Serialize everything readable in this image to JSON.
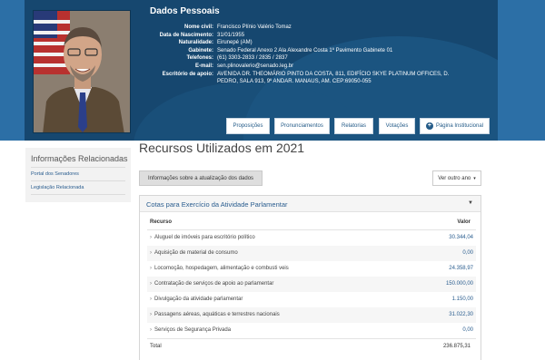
{
  "header": {
    "title": "Dados Pessoais",
    "fields": [
      {
        "label": "Nome civil:",
        "value": "Francisco Plínio Valério Tomaz"
      },
      {
        "label": "Data de Nascimento:",
        "value": "31/01/1955"
      },
      {
        "label": "Naturalidade:",
        "value": "Eirunepé (AM)"
      },
      {
        "label": "Gabinete:",
        "value": "Senado Federal Anexo 2 Ala Alexandre Costa 1º Pavimento Gabinete 01"
      },
      {
        "label": "Telefones:",
        "value": "(61) 3303-2833 / 2835 / 2837"
      },
      {
        "label": "E-mail:",
        "value": "sen.plinovalerio@senado.leg.br"
      },
      {
        "label": "Escritório de apoio:",
        "value": "AVENIDA DR. THEOMÁRIO PINTO DA COSTA, 811, EDIFÍCIO SKYE PLATINUM OFFICES, D.",
        "value2": "PEDRO, SALA 913, 9º ANDAR. MANAUS, AM. CEP:69050-055"
      }
    ],
    "buttons": {
      "proposicoes": "Proposições",
      "pronunciamentos": "Pronunciamentos",
      "relatorias": "Relatorias",
      "votacoes": "Votações",
      "pagina": "Página Institucional"
    }
  },
  "sidebar": {
    "title": "Informações Relacionadas",
    "links": [
      "Portal dos Senadores",
      "Legislação Relacionada"
    ]
  },
  "main": {
    "title": "Recursos Utilizados em 2021",
    "info_button": "Informações sobre a atualização dos dados",
    "year_button": "Ver outro ano",
    "panel": {
      "title": "Cotas para Exercício da Atividade Parlamentar",
      "col_recurso": "Recurso",
      "col_valor": "Valor",
      "rows": [
        {
          "label": "Aluguel de imóveis para escritório político",
          "value": "30.344,04"
        },
        {
          "label": "Aquisição de material de consumo",
          "value": "0,00"
        },
        {
          "label": "Locomoção, hospedagem, alimentação e combusti veis",
          "value": "24.358,97"
        },
        {
          "label": "Contratação de serviços de apoio ao parlamentar",
          "value": "150.000,00"
        },
        {
          "label": "Divulgação da atividade parlamentar",
          "value": "1.150,00"
        },
        {
          "label": "Passagens aéreas, aquáticas e terrestres nacionais",
          "value": "31.022,30"
        },
        {
          "label": "Serviços de Segurança Privada",
          "value": "0,00"
        }
      ],
      "total_label": "Total",
      "total_value": "236.875,31"
    }
  },
  "colors": {
    "header_dark": "#16476f",
    "header_frame": "#2c6fa6",
    "link": "#2a5d8f"
  }
}
